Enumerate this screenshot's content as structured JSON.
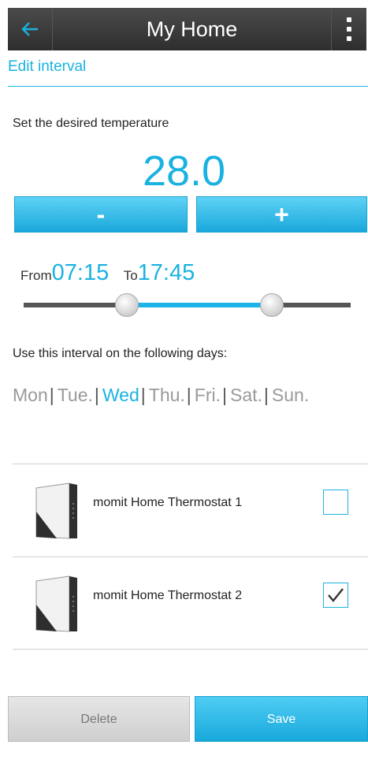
{
  "header": {
    "title": "My Home",
    "back_icon": "arrow-left-icon",
    "menu_icon": "vertical-ellipsis-icon"
  },
  "subheader": {
    "title": "Edit interval"
  },
  "temperature": {
    "label": "Set the desired temperature",
    "value": "28.0",
    "minus_label": "-",
    "plus_label": "+"
  },
  "interval": {
    "from_label": "From",
    "from_value": "07:15",
    "to_label": "To",
    "to_value": "17:45"
  },
  "days": {
    "label": "Use this interval on the following days:",
    "items": [
      {
        "label": "Mon",
        "active": false
      },
      {
        "label": "Tue.",
        "active": false
      },
      {
        "label": "Wed",
        "active": true
      },
      {
        "label": "Thu.",
        "active": false
      },
      {
        "label": "Fri.",
        "active": false
      },
      {
        "label": "Sat.",
        "active": false
      },
      {
        "label": "Sun.",
        "active": false
      }
    ]
  },
  "devices": [
    {
      "name": "momit Home Thermostat 1",
      "checked": false,
      "icon": "thermostat-icon"
    },
    {
      "name": "momit Home Thermostat 2",
      "checked": true,
      "icon": "thermostat-icon"
    }
  ],
  "actions": {
    "delete_label": "Delete",
    "save_label": "Save"
  },
  "colors": {
    "accent": "#1ab2e0",
    "topbar": "#3a3a3a",
    "inactive_day": "#9a9a9a"
  }
}
